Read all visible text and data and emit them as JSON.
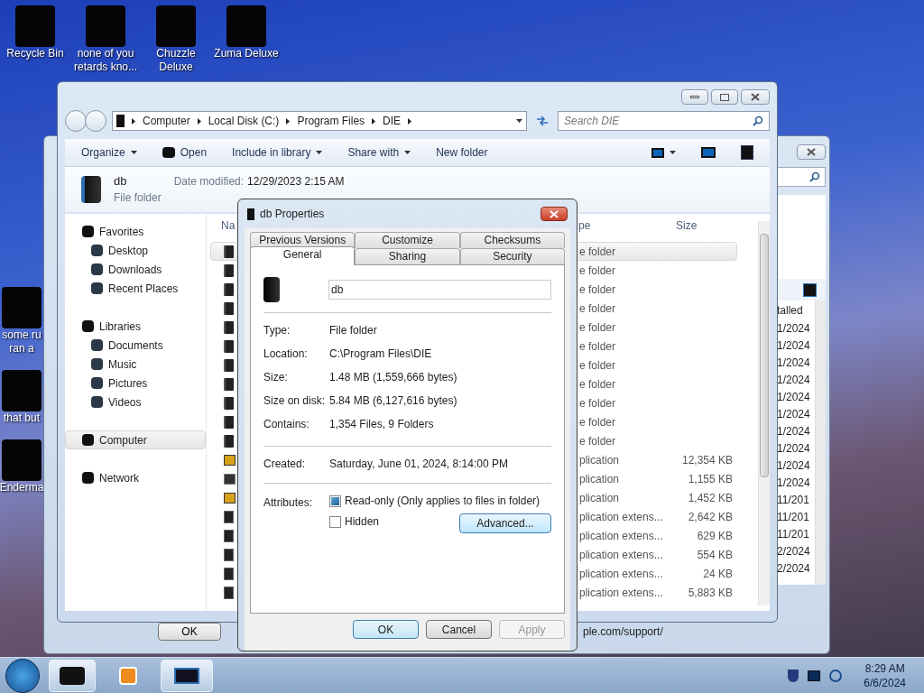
{
  "desktop_icons": [
    {
      "lines": [
        "Recycle Bin"
      ]
    },
    {
      "lines": [
        "none of you",
        "retards kno..."
      ]
    },
    {
      "lines": [
        "Chuzzle",
        "Deluxe"
      ]
    },
    {
      "lines": [
        "Zuma Deluxe"
      ]
    }
  ],
  "desktop_icons_left": [
    {
      "lines": [
        "some ru",
        "ran a"
      ]
    },
    {
      "lines": [
        "that but"
      ]
    },
    {
      "lines": [
        "Enderma"
      ]
    }
  ],
  "background_window": {
    "column_header": "talled",
    "dates": [
      "1/2024",
      "1/2024",
      "1/2024",
      "1/2024",
      "1/2024",
      "1/2024",
      "1/2024",
      "1/2024",
      "1/2024",
      "1/2024",
      "11/201",
      "11/201",
      "11/201",
      "2/2024",
      "2/2024"
    ],
    "footer_button": "OK",
    "link": "ple.com/support/"
  },
  "explorer": {
    "breadcrumb": [
      "Computer",
      "Local Disk (C:)",
      "Program Files",
      "DIE"
    ],
    "search_placeholder": "Search DIE",
    "toolbar": [
      {
        "label": "Organize",
        "kind": "menu"
      },
      {
        "label": "Open",
        "kind": "icon-command"
      },
      {
        "label": "Include in library",
        "kind": "menu"
      },
      {
        "label": "Share with",
        "kind": "menu"
      },
      {
        "label": "New folder",
        "kind": "command"
      }
    ],
    "details": {
      "name": "db",
      "type": "File folder",
      "date_label": "Date modified:",
      "date": "12/29/2023 2:15 AM"
    },
    "nav": [
      {
        "label": "Favorites",
        "selected": false,
        "children": [
          {
            "label": "Desktop",
            "selected": false
          },
          {
            "label": "Downloads",
            "selected": false
          },
          {
            "label": "Recent Places",
            "selected": false
          }
        ]
      },
      {
        "label": "Libraries",
        "selected": false,
        "children": [
          {
            "label": "Documents",
            "selected": false
          },
          {
            "label": "Music",
            "selected": false
          },
          {
            "label": "Pictures",
            "selected": false
          },
          {
            "label": "Videos",
            "selected": false
          }
        ]
      },
      {
        "label": "Computer",
        "selected": true
      },
      {
        "label": "Network",
        "selected": false
      }
    ],
    "file_list": {
      "columns": [
        "Na",
        "pe",
        "Size"
      ],
      "rows": [
        {
          "kind": "folder",
          "type": "e folder",
          "selected": true
        },
        {
          "kind": "folder",
          "type": "e folder",
          "selected": false
        },
        {
          "kind": "folder",
          "type": "e folder",
          "selected": false
        },
        {
          "kind": "folder",
          "type": "e folder",
          "selected": false
        },
        {
          "kind": "folder",
          "type": "e folder",
          "selected": false
        },
        {
          "kind": "folder",
          "type": "e folder",
          "selected": false
        },
        {
          "kind": "folder",
          "type": "e folder",
          "selected": false
        },
        {
          "kind": "folder",
          "type": "e folder",
          "selected": false
        },
        {
          "kind": "folder",
          "type": "e folder",
          "selected": false
        },
        {
          "kind": "folder",
          "type": "e folder",
          "selected": false
        },
        {
          "kind": "folder",
          "type": "e folder",
          "selected": false
        },
        {
          "kind": "app",
          "type": "plication",
          "size": "12,354 KB",
          "selected": false
        },
        {
          "kind": "exe",
          "type": "plication",
          "size": "1,155 KB",
          "selected": false
        },
        {
          "kind": "app",
          "type": "plication",
          "size": "1,452 KB",
          "selected": false
        },
        {
          "kind": "dll",
          "type": "plication extens...",
          "size": "2,642 KB",
          "selected": false
        },
        {
          "kind": "dll",
          "type": "plication extens...",
          "size": "629 KB",
          "selected": false
        },
        {
          "kind": "dll",
          "type": "plication extens...",
          "size": "554 KB",
          "selected": false
        },
        {
          "kind": "dll",
          "type": "plication extens...",
          "size": "24 KB",
          "selected": false
        },
        {
          "kind": "dll",
          "type": "plication extens...",
          "size": "5,883 KB",
          "selected": false
        }
      ]
    }
  },
  "dialog": {
    "title": "db Properties",
    "tab_rows": [
      [
        {
          "label": "Previous Versions",
          "selected": false
        },
        {
          "label": "Customize",
          "selected": false
        },
        {
          "label": "Checksums",
          "selected": false
        }
      ],
      [
        {
          "label": "General",
          "selected": true
        },
        {
          "label": "Sharing",
          "selected": false
        },
        {
          "label": "Security",
          "selected": false
        }
      ]
    ],
    "name": "db",
    "groups": [
      [
        {
          "label": "Type:",
          "value": "File folder"
        },
        {
          "label": "Location:",
          "value": "C:\\Program Files\\DIE"
        },
        {
          "label": "Size:",
          "value": "1.48 MB (1,559,666 bytes)"
        },
        {
          "label": "Size on disk:",
          "value": "5.84 MB (6,127,616 bytes)"
        },
        {
          "label": "Contains:",
          "value": "1,354 Files, 9 Folders"
        }
      ],
      [
        {
          "label": "Created:",
          "value": "Saturday, June 01, 2024, 8:14:00 PM"
        }
      ]
    ],
    "attributes_label": "Attributes:",
    "attributes": [
      {
        "label": "Read-only (Only applies to files in folder)",
        "checked": true
      },
      {
        "label": "Hidden",
        "checked": false
      }
    ],
    "advanced_button": "Advanced...",
    "buttons": [
      {
        "label": "OK",
        "default": true,
        "disabled": false
      },
      {
        "label": "Cancel",
        "default": false,
        "disabled": false
      },
      {
        "label": "Apply",
        "default": false,
        "disabled": true
      }
    ]
  },
  "taskbar": {
    "time": "8:29 AM",
    "date": "6/6/2024"
  }
}
